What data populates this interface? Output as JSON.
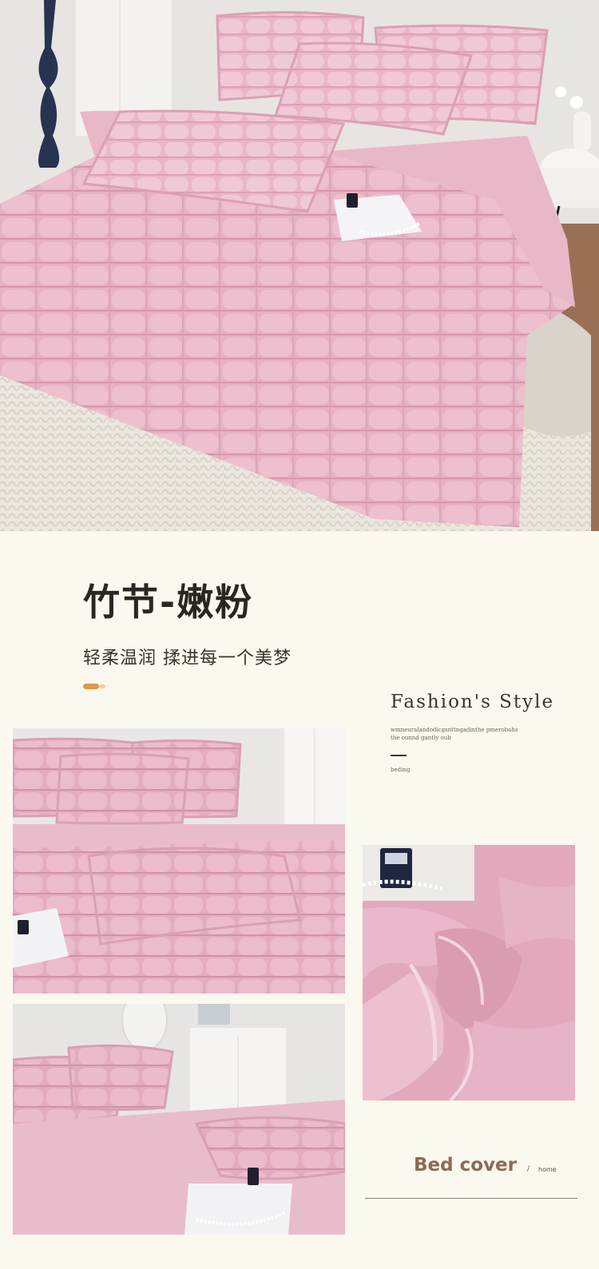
{
  "hero": {
    "image": "pink-bamboo-plush-bedding-room-photo"
  },
  "product": {
    "title": "竹节-嫩粉",
    "subtitle": "轻柔温润 揉进每一个美梦"
  },
  "fashion": {
    "title": "Fashion's Style",
    "body": "wmneuralandodicgsnttngadinthe pmerobahs\nthe ounnd gantly oub",
    "tag": "beding"
  },
  "gallery": {
    "photo_a": "bed-with-pillows-closeup",
    "photo_b": "bedroom-with-cabinet",
    "photo_c": "plush-fabric-detail"
  },
  "footer": {
    "label": "Bed cover",
    "separator": "/",
    "link": "home"
  },
  "colors": {
    "background": "#fbf8ef",
    "pink": "#e6b2c4",
    "accent_orange": "#e0974e",
    "bedcover_brown": "#8b6a56"
  }
}
